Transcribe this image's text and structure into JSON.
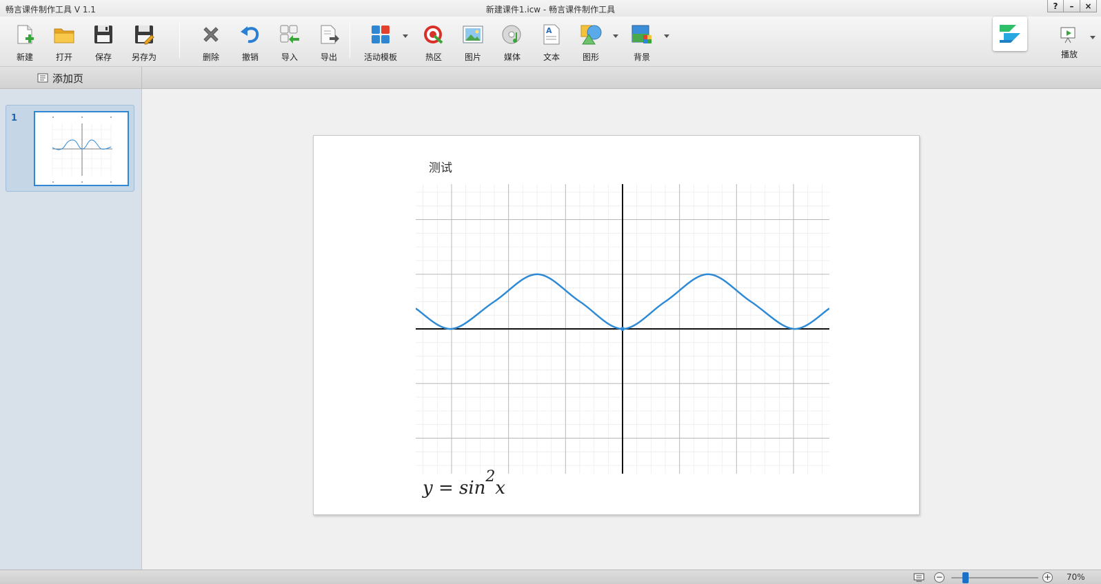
{
  "window": {
    "app_title": "畅言课件制作工具 V 1.1",
    "doc_title": "新建课件1.icw - 畅言课件制作工具",
    "help_label": "?",
    "minimize_label": "–",
    "close_label": "×"
  },
  "toolbar": {
    "new_label": "新建",
    "open_label": "打开",
    "save_label": "保存",
    "saveas_label": "另存为",
    "delete_label": "删除",
    "undo_label": "撤销",
    "import_label": "导入",
    "export_label": "导出",
    "template_label": "活动模板",
    "hotspot_label": "热区",
    "image_label": "图片",
    "media_label": "媒体",
    "text_label": "文本",
    "shape_label": "图形",
    "background_label": "背景",
    "play_label": "播放"
  },
  "pagebar": {
    "add_page_label": "添加页"
  },
  "slides": [
    {
      "number": "1"
    }
  ],
  "slide": {
    "title": "测试",
    "formula": {
      "prefix": "y = sin",
      "exponent": "2",
      "suffix": "x"
    }
  },
  "chart_data": {
    "type": "line",
    "title": "",
    "function": "y = sin^2 x",
    "series": [
      {
        "x": [
          -3.8,
          -3.1416,
          -2.3562,
          -1.5708,
          -0.7854,
          0,
          0.7854,
          1.5708,
          2.3562,
          3.1416,
          3.8
        ],
        "y": [
          0.374,
          0,
          0.5,
          1,
          0.5,
          0,
          0.5,
          1,
          0.5,
          0,
          0.374
        ]
      }
    ],
    "xlim": [
      -3.8,
      3.8
    ],
    "ylim": [
      -2.65,
      2.65
    ],
    "grid": true,
    "line_color": "#2f8ad6"
  },
  "statusbar": {
    "zoom_out_label": "−",
    "zoom_in_label": "+",
    "zoom_level": "70%",
    "zoom_fraction": 0.16
  },
  "colors": {
    "accent": "#2f86d2",
    "side_panel": "#d8e1ea"
  }
}
